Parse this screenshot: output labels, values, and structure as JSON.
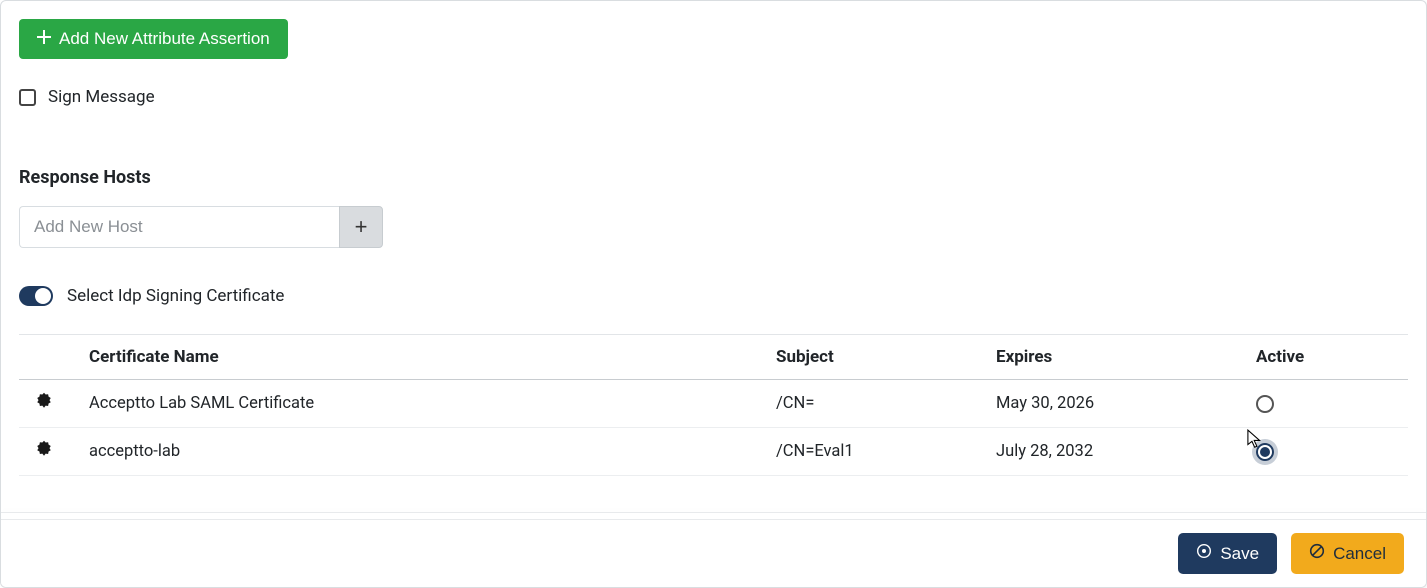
{
  "buttons": {
    "add_attribute": "Add New Attribute Assertion",
    "save": "Save",
    "cancel": "Cancel"
  },
  "sign_message": {
    "label": "Sign Message",
    "checked": false
  },
  "response_hosts": {
    "title": "Response Hosts",
    "placeholder": "Add New Host"
  },
  "idp_signing": {
    "label": "Select Idp Signing Certificate",
    "enabled": true
  },
  "cert_table": {
    "headers": {
      "name": "Certificate Name",
      "subject": "Subject",
      "expires": "Expires",
      "active": "Active"
    },
    "rows": [
      {
        "name": "Acceptto Lab SAML Certificate",
        "subject": "/CN=",
        "expires": "May 30, 2026",
        "active": false
      },
      {
        "name": "acceptto-lab",
        "subject": "/CN=Eval1",
        "expires": "July 28, 2032",
        "active": true
      }
    ]
  }
}
